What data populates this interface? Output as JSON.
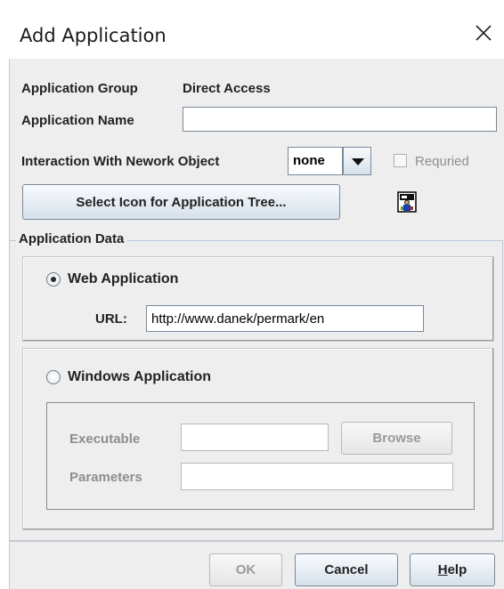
{
  "dialog": {
    "title": "Add Application"
  },
  "form": {
    "group_label": "Application Group",
    "group_value": "Direct Access",
    "name_label": "Application Name",
    "name_value": "",
    "interaction_label": "Interaction With Nework Object",
    "interaction_selected": "none",
    "required_label": "Requried",
    "required_checked": false,
    "select_icon_label": "Select Icon for Application Tree...",
    "tree_icon": "application-tree-icon"
  },
  "app_data": {
    "title": "Application Data",
    "web": {
      "label": "Web Application",
      "selected": true,
      "url_label": "URL:",
      "url_value": "http://www.danek/permark/en"
    },
    "windows": {
      "label": "Windows Application",
      "selected": false,
      "exec_label": "Executable",
      "exec_value": "",
      "browse_label": "Browse",
      "params_label": "Parameters",
      "params_value": ""
    }
  },
  "buttons": {
    "ok": "OK",
    "cancel": "Cancel",
    "help": "Help"
  }
}
